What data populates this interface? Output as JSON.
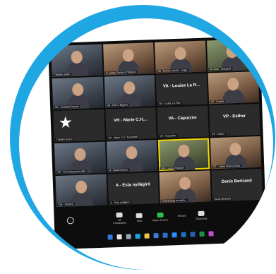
{
  "meeting": {
    "tiles": [
      {
        "name": "",
        "label": "Théâtre action",
        "kind": "video",
        "tone": "cool"
      },
      {
        "name": "",
        "label": "G_Augis Gomes (Théâtre)",
        "kind": "video",
        "tone": "warm"
      },
      {
        "name": "",
        "label": "VA - Michel Labelle - Sujet",
        "kind": "video",
        "tone": "warm"
      },
      {
        "name": "",
        "label": "VA Jean - Gaspard",
        "kind": "video",
        "tone": "green"
      },
      {
        "name": "",
        "label": "GL - Gutrand Dupont",
        "kind": "video",
        "tone": "cool"
      },
      {
        "name": "",
        "label": "VA - Pierre Bigault",
        "kind": "video",
        "tone": "cool"
      },
      {
        "name": "VA - Louise La R...",
        "label": "VA - Louise La Rue",
        "kind": "name"
      },
      {
        "name": "",
        "label": "VP - Franck",
        "kind": "video",
        "tone": "warm"
      },
      {
        "name": "",
        "label": "Théâtre action",
        "kind": "logo"
      },
      {
        "name": "VH - Marie C.H....",
        "label": "VH - Marie C.H. Touchette",
        "kind": "name"
      },
      {
        "name": "VA - Capucine",
        "label": "VA - Capucine",
        "kind": "name"
      },
      {
        "name": "VP - Esther",
        "label": "VP - Esther",
        "kind": "name"
      },
      {
        "name": "",
        "label": "VP - Yo Imida parent Alle",
        "kind": "video",
        "tone": "cool"
      },
      {
        "name": "",
        "label": "A - David Dufour",
        "kind": "video",
        "tone": "cool"
      },
      {
        "name": "",
        "label": "VP - Louise Paulard",
        "kind": "video",
        "tone": "green",
        "active": true
      },
      {
        "name": "",
        "label": "CT - Leslie Flamm Piton",
        "kind": "video",
        "tone": "warm"
      },
      {
        "name": "",
        "label": "GH - Vincent",
        "kind": "video",
        "tone": "cool"
      },
      {
        "name": "A - Esta nyilágíró",
        "label": "A - Esta nyilágíró",
        "kind": "name"
      },
      {
        "name": "",
        "label": "Connecting to audio...",
        "kind": "video",
        "tone": "warm"
      },
      {
        "name": "Denis Bertrand",
        "label": "Denis Bertrand",
        "kind": "name"
      }
    ],
    "toolbar": [
      {
        "label": "Participants",
        "count": "28",
        "icon": "participants-icon"
      },
      {
        "label": "Chat",
        "icon": "chat-icon"
      },
      {
        "label": "Share Screen",
        "icon": "share-screen-icon"
      },
      {
        "label": "Record",
        "icon": "record-icon"
      },
      {
        "label": "Reactions",
        "icon": "reactions-icon"
      }
    ],
    "taskbar_icons": [
      {
        "icon": "windows-start-icon",
        "color": "#2f7de1"
      },
      {
        "icon": "search-icon",
        "color": "#e6e6e6"
      },
      {
        "icon": "task-view-icon",
        "color": "#9aa4b2"
      },
      {
        "icon": "edge-icon",
        "color": "#1aa3d8"
      },
      {
        "icon": "explorer-icon",
        "color": "#f2c14e"
      },
      {
        "icon": "store-icon",
        "color": "#3a7bd5"
      },
      {
        "icon": "mail-icon",
        "color": "#2a6fc9"
      },
      {
        "icon": "zoom-icon",
        "color": "#2d8cff"
      },
      {
        "icon": "outlook-icon",
        "color": "#1f6fc5"
      },
      {
        "icon": "word-icon",
        "color": "#2b5fb3"
      },
      {
        "icon": "excel-icon",
        "color": "#1e8e4e"
      },
      {
        "icon": "app-icon",
        "color": "#c44ad1"
      }
    ]
  }
}
